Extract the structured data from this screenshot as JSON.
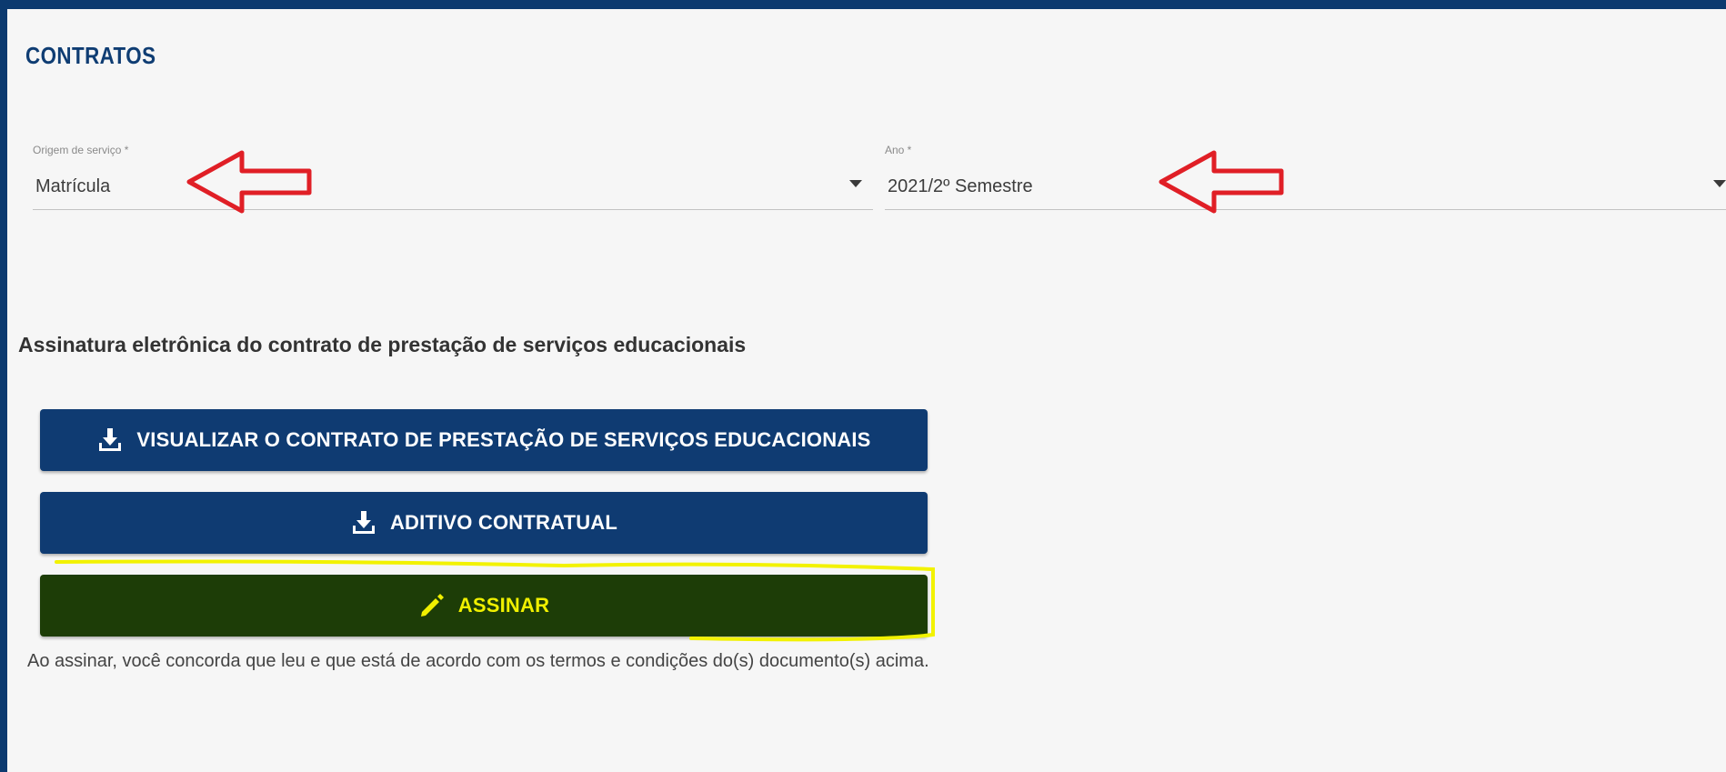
{
  "page": {
    "title": "CONTRATOS"
  },
  "form": {
    "origem": {
      "label": "Origem de serviço *",
      "value": "Matrícula"
    },
    "ano": {
      "label": "Ano *",
      "value": "2021/2º Semestre"
    }
  },
  "section": {
    "heading": "Assinatura eletrônica do contrato de prestação de serviços educacionais"
  },
  "buttons": {
    "contrato_label": "VISUALIZAR O CONTRATO DE PRESTAÇÃO DE SERVIÇOS EDUCACIONAIS",
    "aditivo_label": "ADITIVO CONTRATUAL",
    "assinar_label": "ASSINAR"
  },
  "disclaimer": "Ao assinar, você concorda que leu e que está de acordo com os termos e condições do(s) documento(s) acima.",
  "icons": {
    "download": "download-icon",
    "pencil": "pencil-icon",
    "dropdown": "chevron-down-icon",
    "annotation": "red-arrow-annotation"
  },
  "colors": {
    "header_bar": "#0c3a6f",
    "title": "#0f3d73",
    "button_primary": "#0f3b72",
    "button_sign": "#1d3d07",
    "button_sign_text": "#f0f000",
    "annotation_red": "#e01f26",
    "highlight_yellow": "#f2f200"
  }
}
